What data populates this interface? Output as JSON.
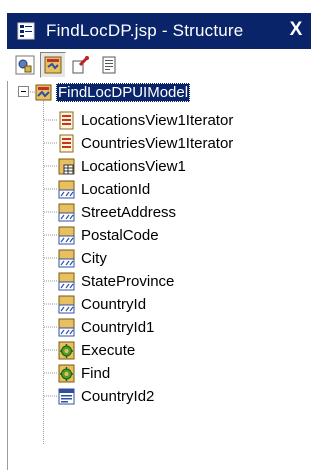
{
  "window": {
    "title": "FindLocDP.jsp - Structure",
    "close_label": "X"
  },
  "colors": {
    "title_bg": "#0a246a",
    "selection_bg": "#0a246a"
  },
  "toolbar": {
    "buttons": [
      {
        "icon": "data-control-icon",
        "pressed": false
      },
      {
        "icon": "binding-icon",
        "pressed": true
      },
      {
        "icon": "page-flow-icon",
        "pressed": false
      },
      {
        "icon": "page-icon",
        "pressed": false
      }
    ]
  },
  "tree": {
    "root": {
      "label": "FindLocDPUIModel",
      "icon": "model-icon",
      "expanded": true,
      "selected": true
    },
    "children": [
      {
        "label": "LocationsView1Iterator",
        "icon": "iterator-icon"
      },
      {
        "label": "CountriesView1Iterator",
        "icon": "iterator-icon"
      },
      {
        "label": "LocationsView1",
        "icon": "view-object-icon"
      },
      {
        "label": "LocationId",
        "icon": "attribute-icon"
      },
      {
        "label": "StreetAddress",
        "icon": "attribute-icon"
      },
      {
        "label": "PostalCode",
        "icon": "attribute-icon"
      },
      {
        "label": "City",
        "icon": "attribute-icon"
      },
      {
        "label": "StateProvince",
        "icon": "attribute-icon"
      },
      {
        "label": "CountryId",
        "icon": "attribute-icon"
      },
      {
        "label": "CountryId1",
        "icon": "attribute-icon"
      },
      {
        "label": "Execute",
        "icon": "action-icon"
      },
      {
        "label": "Find",
        "icon": "action-icon"
      },
      {
        "label": "CountryId2",
        "icon": "list-icon"
      }
    ]
  }
}
